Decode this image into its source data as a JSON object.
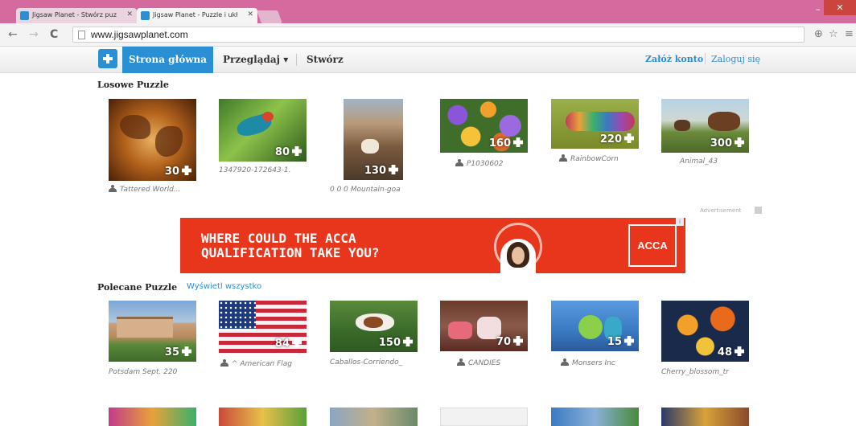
{
  "browser": {
    "tabs": [
      {
        "title": "Jigsaw Planet - Stwórz puz"
      },
      {
        "title": "Jigsaw Planet - Puzzle i ukł"
      }
    ],
    "url": "www.jigsawplanet.com",
    "nav": {
      "back": "←",
      "forward": "→",
      "reload": "C"
    },
    "controls": {
      "minimize": "–",
      "maximize": "❐",
      "close": "✕",
      "zoom": "⊕",
      "star": "☆",
      "menu": "≡"
    }
  },
  "site": {
    "nav": {
      "home": "Strona główna",
      "browse": "Przeglądaj ▾",
      "create": "Stwórz"
    },
    "account": {
      "register": "Załóż konto",
      "login": "Zaloguj się"
    },
    "colors": {
      "accent": "#2a8fd3",
      "ad_bg": "#e8361c"
    }
  },
  "random_section": {
    "title": "Losowe Puzzle",
    "items": [
      {
        "pieces": "30",
        "caption": "Tattered World...",
        "has_user_icon": true
      },
      {
        "pieces": "80",
        "caption": "1347920-172643-1.",
        "has_user_icon": false
      },
      {
        "pieces": "130",
        "caption": "0 0 0 Mountain-goa",
        "has_user_icon": false
      },
      {
        "pieces": "160",
        "caption": "P1030602",
        "has_user_icon": true
      },
      {
        "pieces": "220",
        "caption": "RainbowCorn",
        "has_user_icon": true
      },
      {
        "pieces": "300",
        "caption": "Animal_43",
        "has_user_icon": false
      }
    ]
  },
  "ad": {
    "headline_1": "WHERE COULD THE ACCA",
    "headline_2": "QUALIFICATION TAKE YOU?",
    "logo": "ACCA",
    "choice_icon": "i",
    "label": "Advertisement"
  },
  "featured_section": {
    "title": "Polecane Puzzle",
    "view_all": "Wyświetl wszystko",
    "items": [
      {
        "pieces": "35",
        "caption": "Potsdam Sept. 220",
        "has_user_icon": false
      },
      {
        "pieces": "84",
        "caption": "^ American Flag",
        "has_user_icon": true
      },
      {
        "pieces": "150",
        "caption": "Caballos-Corriendo_",
        "has_user_icon": false
      },
      {
        "pieces": "70",
        "caption": "CANDIES",
        "has_user_icon": true
      },
      {
        "pieces": "15",
        "caption": "Monsers Inc",
        "has_user_icon": true
      },
      {
        "pieces": "48",
        "caption": "Cherry_blossom_tr",
        "has_user_icon": false
      }
    ]
  }
}
